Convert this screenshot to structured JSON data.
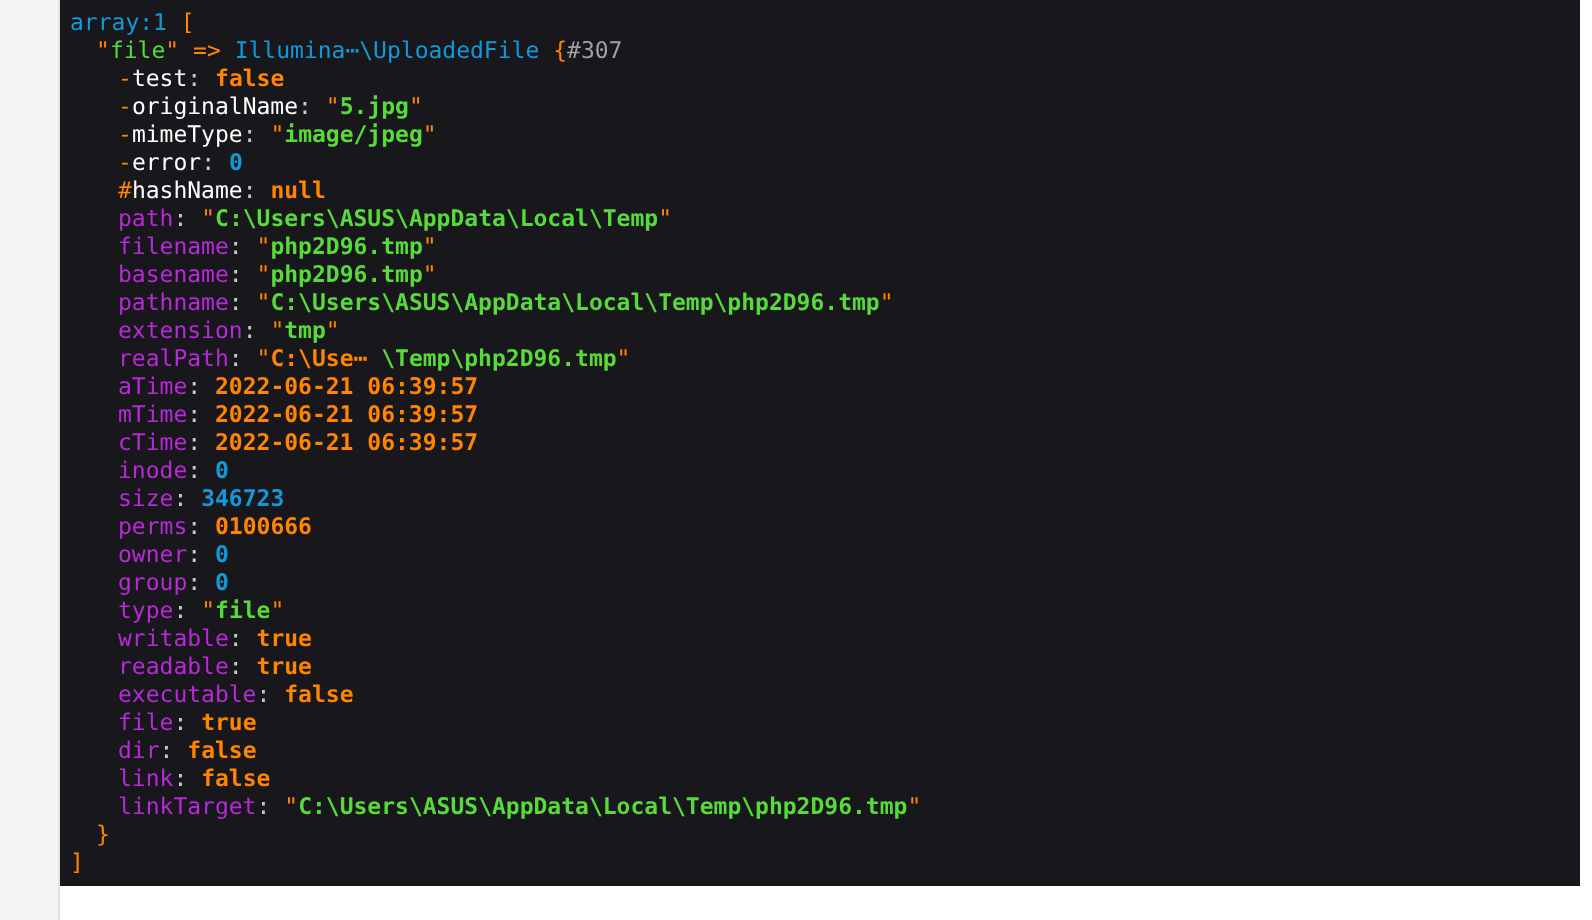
{
  "dump": {
    "label": "array:1",
    "open": "[",
    "close": "]",
    "entry": {
      "key": "\"file\"",
      "arrow": "=>",
      "class": "Illumina⋯\\UploadedFile",
      "open": "{",
      "ref": "#307",
      "close": "}",
      "properties": [
        {
          "marked": true,
          "key": "-test:",
          "kind": "const",
          "value": "false"
        },
        {
          "marked": true,
          "key": "-originalName:",
          "kind": "string",
          "value": "\"5.jpg\""
        },
        {
          "marked": true,
          "key": "-mimeType:",
          "kind": "string",
          "value": "\"image/jpeg\""
        },
        {
          "marked": true,
          "key": "-error:",
          "kind": "number",
          "value": "0"
        },
        {
          "marked": true,
          "key": "#hashName:",
          "kind": "const",
          "value": "null"
        },
        {
          "marked": false,
          "key": "path:",
          "kind": "string",
          "value": "\"C:\\Users\\ASUS\\AppData\\Local\\Temp\""
        },
        {
          "marked": false,
          "key": "filename:",
          "kind": "string",
          "value": "\"php2D96.tmp\""
        },
        {
          "marked": false,
          "key": "basename:",
          "kind": "string",
          "value": "\"php2D96.tmp\""
        },
        {
          "marked": false,
          "key": "pathname:",
          "kind": "string",
          "value": "\"C:\\Users\\ASUS\\AppData\\Local\\Temp\\php2D96.tmp\""
        },
        {
          "marked": false,
          "key": "extension:",
          "kind": "string",
          "value": "\"tmp\""
        },
        {
          "marked": false,
          "key": "realPath:",
          "kind": "abbr",
          "value": "\"C:\\Use⋯ \\Temp\\php2D96.tmp\""
        },
        {
          "marked": false,
          "key": "aTime:",
          "kind": "const",
          "value": "2022-06-21 06:39:57"
        },
        {
          "marked": false,
          "key": "mTime:",
          "kind": "const",
          "value": "2022-06-21 06:39:57"
        },
        {
          "marked": false,
          "key": "cTime:",
          "kind": "const",
          "value": "2022-06-21 06:39:57"
        },
        {
          "marked": false,
          "key": "inode:",
          "kind": "number",
          "value": "0"
        },
        {
          "marked": false,
          "key": "size:",
          "kind": "number",
          "value": "346723"
        },
        {
          "marked": false,
          "key": "perms:",
          "kind": "const",
          "value": "0100666"
        },
        {
          "marked": false,
          "key": "owner:",
          "kind": "number",
          "value": "0"
        },
        {
          "marked": false,
          "key": "group:",
          "kind": "number",
          "value": "0"
        },
        {
          "marked": false,
          "key": "type:",
          "kind": "string",
          "value": "\"file\""
        },
        {
          "marked": false,
          "key": "writable:",
          "kind": "const",
          "value": "true"
        },
        {
          "marked": false,
          "key": "readable:",
          "kind": "const",
          "value": "true"
        },
        {
          "marked": false,
          "key": "executable:",
          "kind": "const",
          "value": "false"
        },
        {
          "marked": false,
          "key": "file:",
          "kind": "const",
          "value": "true"
        },
        {
          "marked": false,
          "key": "dir:",
          "kind": "const",
          "value": "false"
        },
        {
          "marked": false,
          "key": "link:",
          "kind": "const",
          "value": "false"
        },
        {
          "marked": false,
          "key": "linkTarget:",
          "kind": "string",
          "value": "\"C:\\Users\\ASUS\\AppData\\Local\\Temp\\php2D96.tmp\""
        }
      ]
    }
  }
}
